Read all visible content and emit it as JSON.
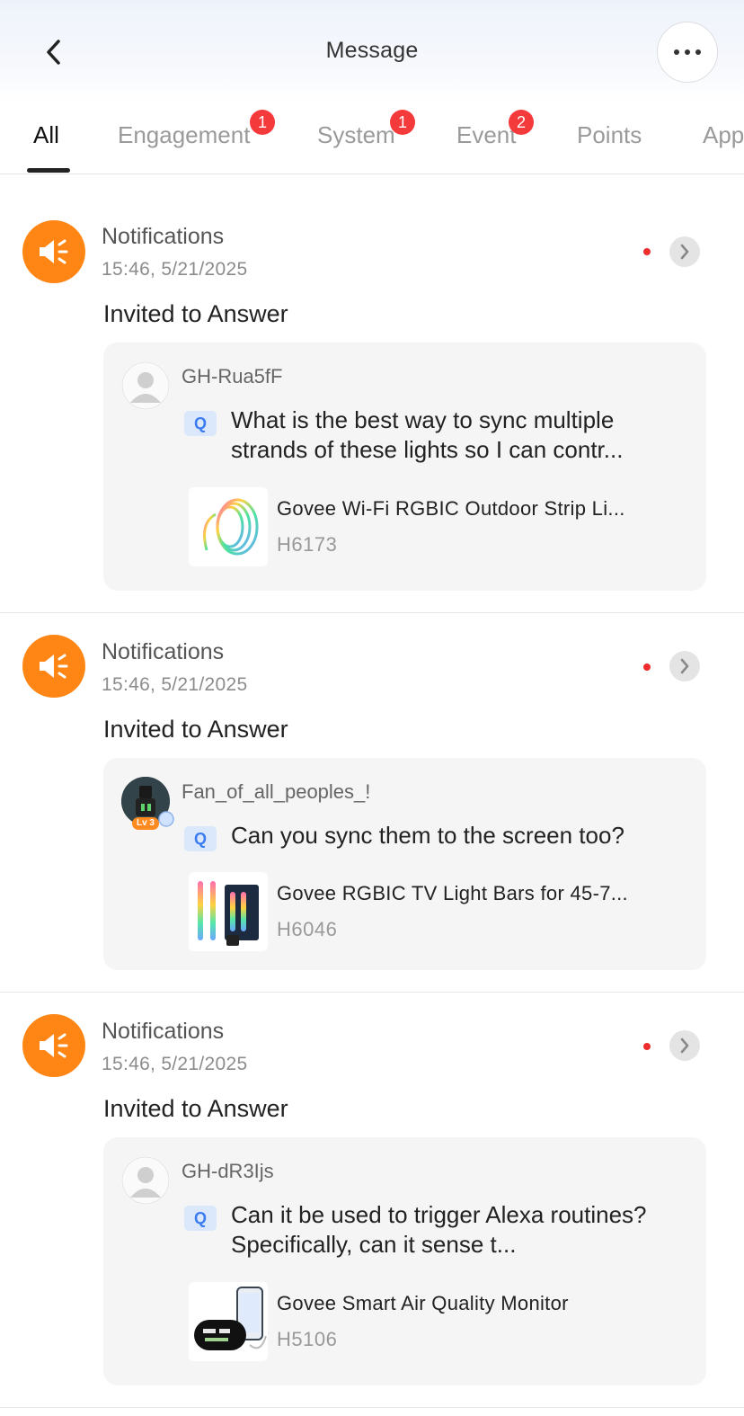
{
  "header": {
    "title": "Message",
    "back_icon": "chevron-left-icon",
    "more_icon": "more-horizontal-icon"
  },
  "tabs": [
    {
      "label": "All",
      "active": true,
      "badge": null
    },
    {
      "label": "Engagement",
      "active": false,
      "badge": "1"
    },
    {
      "label": "System",
      "active": false,
      "badge": "1"
    },
    {
      "label": "Event",
      "active": false,
      "badge": "2"
    },
    {
      "label": "Points",
      "active": false,
      "badge": null
    },
    {
      "label": "App",
      "active": false,
      "badge": null
    }
  ],
  "messages": [
    {
      "icon": "megaphone-icon",
      "sender": "Notifications",
      "time": "15:46,  5/21/2025",
      "unread": true,
      "headline": "Invited to Answer",
      "user": "GH-Rua5fF",
      "q_label": "Q",
      "question": "What is the best way to sync multiple strands of these lights so I can contr...",
      "product_name": "Govee Wi-Fi RGBIC Outdoor Strip Li...",
      "product_model": "H6173"
    },
    {
      "icon": "megaphone-icon",
      "sender": "Notifications",
      "time": "15:46,  5/21/2025",
      "unread": true,
      "headline": "Invited to Answer",
      "user": "Fan_of_all_peoples_!",
      "user_level": "Lv 3",
      "q_label": "Q",
      "question": "Can you sync them to the screen too?",
      "product_name": "Govee RGBIC TV Light Bars for 45-7...",
      "product_model": "H6046"
    },
    {
      "icon": "megaphone-icon",
      "sender": "Notifications",
      "time": "15:46,  5/21/2025",
      "unread": true,
      "headline": "Invited to Answer",
      "user": "GH-dR3Ijs",
      "q_label": "Q",
      "question": "Can it be used to trigger Alexa routines? Specifically, can it sense t...",
      "product_name": "Govee Smart Air Quality Monitor",
      "product_model": "H5106"
    }
  ],
  "colors": {
    "accent_orange": "#ff8514",
    "badge_red": "#f43a3a",
    "q_blue": "#3a7cf0",
    "panel_bg": "#f5f5f5"
  }
}
